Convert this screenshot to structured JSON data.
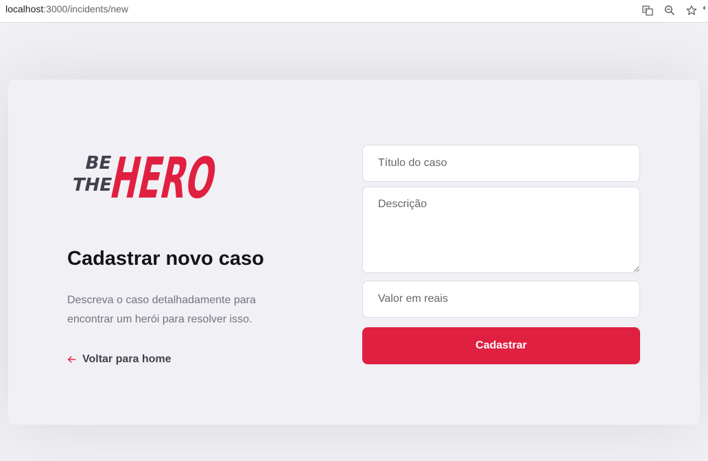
{
  "browser": {
    "url_host": "localhost",
    "url_rest": ":3000/incidents/new",
    "icons": [
      "translate-icon",
      "zoom-out-icon",
      "star-icon"
    ]
  },
  "logo": {
    "line1": "BE",
    "line2": "THE",
    "word": "HERO"
  },
  "page": {
    "title": "Cadastrar novo caso",
    "description": "Descreva o caso detalhadamente para encontrar um herói para resolver isso.",
    "back_label": "Voltar para home"
  },
  "form": {
    "title_placeholder": "Título do caso",
    "title_value": "",
    "description_placeholder": "Descrição",
    "description_value": "",
    "value_placeholder": "Valor em reais",
    "value_value": "",
    "submit_label": "Cadastrar"
  },
  "colors": {
    "accent": "#e02041",
    "background": "#f0f0f5",
    "heading": "#13131a",
    "muted": "#737380",
    "logo_dark": "#41414d"
  }
}
